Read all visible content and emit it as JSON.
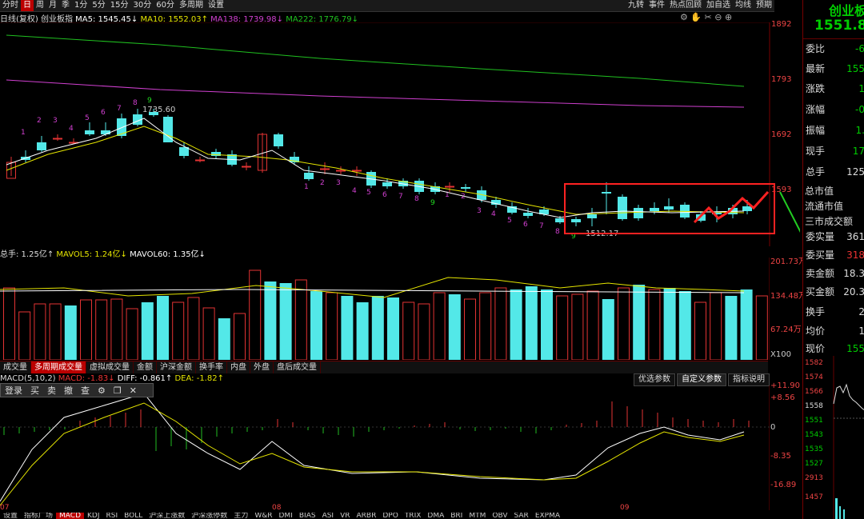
{
  "toolbar": {
    "tabs": [
      "分时",
      "日",
      "周",
      "月",
      "季",
      "1分",
      "5分",
      "15分",
      "30分",
      "60分",
      "多周期",
      "设置"
    ],
    "active": "日",
    "right_items": [
      "九转",
      "事件",
      "热点回顾",
      "加自选",
      "均线",
      "预期"
    ]
  },
  "ma_line": {
    "prefix": "日线(复权) 创业板指",
    "ma5": "MA5: 1545.45↓",
    "ma10": "MA10: 1552.03↑",
    "ma138": "MA138: 1739.98↓",
    "ma222": "MA222: 1776.79↓"
  },
  "price_axis": [
    "1892",
    "1793",
    "1692",
    "1593"
  ],
  "annotations": {
    "high": "1735.60",
    "low": "1512.17"
  },
  "vol_line": {
    "total": "总手: 1.25亿↑",
    "mavol5": "MAVOL5: 1.24亿↓",
    "mavol60": "MAVOL60: 1.35亿↓"
  },
  "vol_axis": [
    "201.73万",
    "134.48万",
    "67.24万",
    "X100"
  ],
  "vol_tabs": [
    "成交量",
    "多周期成交量",
    "虚拟成交量",
    "金额",
    "沪深金额",
    "换手率",
    "内盘",
    "外盘",
    "盘后成交量"
  ],
  "vol_tab_active": "多周期成交量",
  "macd_line": {
    "prefix": "MACD(5,10,2)",
    "macd": "MACD: -1.83↓",
    "diff": "DIFF: -0.861↑",
    "dea": "DEA: -1.82↑"
  },
  "trade_bar": [
    "登录",
    "买",
    "卖",
    "撤",
    "查"
  ],
  "macd_buttons": [
    "优选参数",
    "自定义参数",
    "指标说明"
  ],
  "macd_axis": [
    "+11.90",
    "+8.56",
    "0",
    "-8.35",
    "-16.89"
  ],
  "months": [
    "07",
    "08",
    "09"
  ],
  "bottom_tabs": [
    "设置",
    "指标广场",
    "MACD",
    "KDJ",
    "RSI",
    "BOLL",
    "沪深上涨数",
    "沪深涨停数",
    "主力",
    "W&R",
    "DMI",
    "BIAS",
    "ASI",
    "VR",
    "ARBR",
    "DPO",
    "TRIX",
    "DMA",
    "BRI",
    "MTM",
    "OBV",
    "SAR",
    "EXPMA"
  ],
  "bottom_tab_active": "MACD",
  "side": {
    "title": "创业板",
    "price": "1551.8",
    "rows": [
      {
        "k": "委比",
        "v": "-6"
      },
      {
        "k": "最新",
        "v": "155"
      },
      {
        "k": "涨跌",
        "v": "1"
      },
      {
        "k": "涨幅",
        "v": "-0"
      },
      {
        "k": "振幅",
        "v": "1."
      },
      {
        "k": "现手",
        "v": "17"
      },
      {
        "k": "总手",
        "v": "125"
      }
    ],
    "overlay_rows": [
      "总市值",
      "流通市值",
      "三市成交额"
    ],
    "rows2": [
      {
        "k": "委实量",
        "v": "361"
      },
      {
        "k": "委买量",
        "v": "318"
      },
      {
        "k": "卖金额",
        "v": "18.3"
      },
      {
        "k": "买金额",
        "v": "20.3"
      },
      {
        "k": "换手",
        "v": "2"
      },
      {
        "k": "均价",
        "v": "1"
      },
      {
        "k": "现价",
        "v": "155"
      }
    ],
    "mini_axis": [
      "1582",
      "1574",
      "1566",
      "1558",
      "1551",
      "1543",
      "1535",
      "1527",
      "2913",
      "1457"
    ]
  },
  "colors": {
    "up": "#e33333",
    "down": "#53e8e8",
    "ma5": "#ffffff",
    "ma10": "#e5e500",
    "ma138": "#d040d0",
    "ma222": "#20c020"
  }
}
